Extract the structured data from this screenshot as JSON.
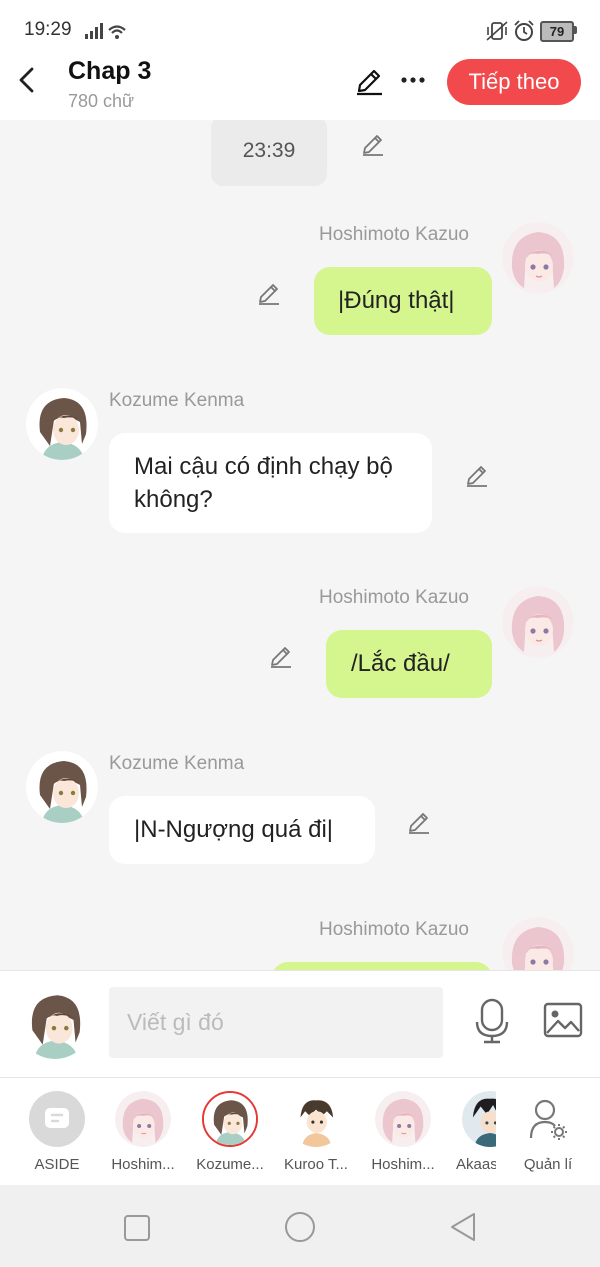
{
  "status_bar": {
    "time": "19:29",
    "battery": "79"
  },
  "header": {
    "title": "Chap 3",
    "word_count": "780 chữ",
    "next_label": "Tiếp theo"
  },
  "messages": [
    {
      "type": "timestamp",
      "text": "23:39"
    },
    {
      "side": "right",
      "sender": "Hoshimoto Kazuo",
      "text": "|Đúng thật|"
    },
    {
      "side": "left",
      "sender": "Kozume Kenma",
      "text": "Mai cậu có định chạy bộ không?"
    },
    {
      "side": "right",
      "sender": "Hoshimoto Kazuo",
      "text": "/Lắc đầu/"
    },
    {
      "side": "left",
      "sender": "Kozume Kenma",
      "text": "|N-Ngượng quá đi|"
    },
    {
      "side": "right",
      "sender": "Hoshimoto Kazuo",
      "text": ""
    }
  ],
  "composer": {
    "placeholder": "Viết gì đó"
  },
  "characters": [
    {
      "label": "ASIDE",
      "icon": "aside-icon"
    },
    {
      "label": "Hoshim...",
      "icon": "pink-hair-avatar"
    },
    {
      "label": "Kozume...",
      "icon": "brown-hair-avatar",
      "selected": true
    },
    {
      "label": "Kuroo T...",
      "icon": "dark-hair-avatar"
    },
    {
      "label": "Hoshim...",
      "icon": "pink-hair-avatar"
    },
    {
      "label": "Akaas",
      "icon": "black-hair-avatar"
    },
    {
      "label": "Quản lí",
      "icon": "manage-user-icon"
    }
  ],
  "colors": {
    "accent": "#f2494d",
    "right_bubble": "#d5f58e",
    "left_bubble": "#ffffff",
    "background": "#f5f5f5"
  }
}
